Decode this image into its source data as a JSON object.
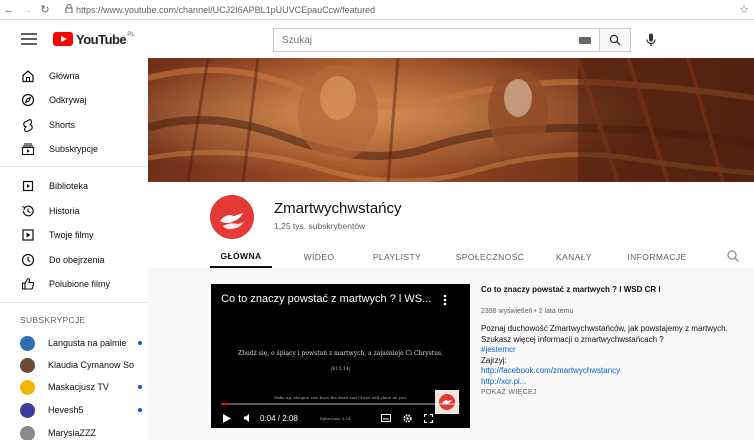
{
  "browser": {
    "url": "https://www.youtube.com/channel/UCJ2I6APBL1pUUVCEpauCcw/featured"
  },
  "masthead": {
    "logo_text": "YouTube",
    "logo_region": "PL",
    "search_placeholder": "Szukaj"
  },
  "sidebar": {
    "main_items": [
      {
        "label": "Główna",
        "icon": "home-icon"
      },
      {
        "label": "Odkrywaj",
        "icon": "compass-icon"
      },
      {
        "label": "Shorts",
        "icon": "shorts-icon"
      },
      {
        "label": "Subskrypcje",
        "icon": "subscriptions-icon"
      }
    ],
    "library_items": [
      {
        "label": "Biblioteka",
        "icon": "library-icon"
      },
      {
        "label": "Historia",
        "icon": "history-icon"
      },
      {
        "label": "Twoje filmy",
        "icon": "your-videos-icon"
      },
      {
        "label": "Do obejrzenia",
        "icon": "watch-later-icon"
      },
      {
        "label": "Polubione filmy",
        "icon": "thumb-up-icon"
      }
    ],
    "subscriptions_heading": "SUBSKRYPCJE",
    "subscriptions": [
      {
        "label": "Langusta na palmie",
        "new": true,
        "color": "#2f6fb5"
      },
      {
        "label": "Klaudia Cymanow So...",
        "new": false,
        "color": "#6b4a3a"
      },
      {
        "label": "Maskacjusz TV",
        "new": true,
        "color": "#f2b705"
      },
      {
        "label": "Hevesh5",
        "new": true,
        "color": "#3b3b9a"
      },
      {
        "label": "MarysiaZZZ",
        "new": false,
        "color": "#8a8a8a"
      }
    ]
  },
  "channel": {
    "name": "Zmartwychwstańcy",
    "subscribers": "1,25 tys. subskrybentów",
    "brand_color": "#e53935",
    "tabs": [
      {
        "label": "GŁÓWNA",
        "active": true
      },
      {
        "label": "WIDEO",
        "active": false
      },
      {
        "label": "PLAYLISTY",
        "active": false
      },
      {
        "label": "SPOŁECZNOŚĆ",
        "active": false
      },
      {
        "label": "KANAŁY",
        "active": false
      },
      {
        "label": "INFORMACJE",
        "active": false
      }
    ]
  },
  "player": {
    "title": "Co to znaczy powstać z martwych ? l WS...",
    "quote": "Zbudź się, o śpiący i powstań z martwych, a zajaśnieje Ci Chrystus.",
    "quote_ref": "(Ef 5,14)",
    "quote_en": "Wake up, sleeper, rise from the dead and Christ will shine on you.",
    "time": "0:04 / 2:08",
    "time_ref": "Ephesians 5:14",
    "progress": 0.03
  },
  "featured": {
    "title": "Co to znaczy powstać z martwych ? l WSD CR l",
    "meta": "2398 wyświetleń • 2 lata temu",
    "desc_line1": "Poznaj duchowość Zmartwychwstańców, jak powstajemy z martwych.",
    "desc_line2": "Szukasz więcej informacji o zmartwychwstańcach ?",
    "hashtag": "#jestemcr",
    "desc_line3": "Zajrzyj:",
    "link1": "http://facebook.com/zmartwychwstancy",
    "link2": "http://xcr.pl...",
    "more": "POKAŻ WIĘCEJ"
  }
}
